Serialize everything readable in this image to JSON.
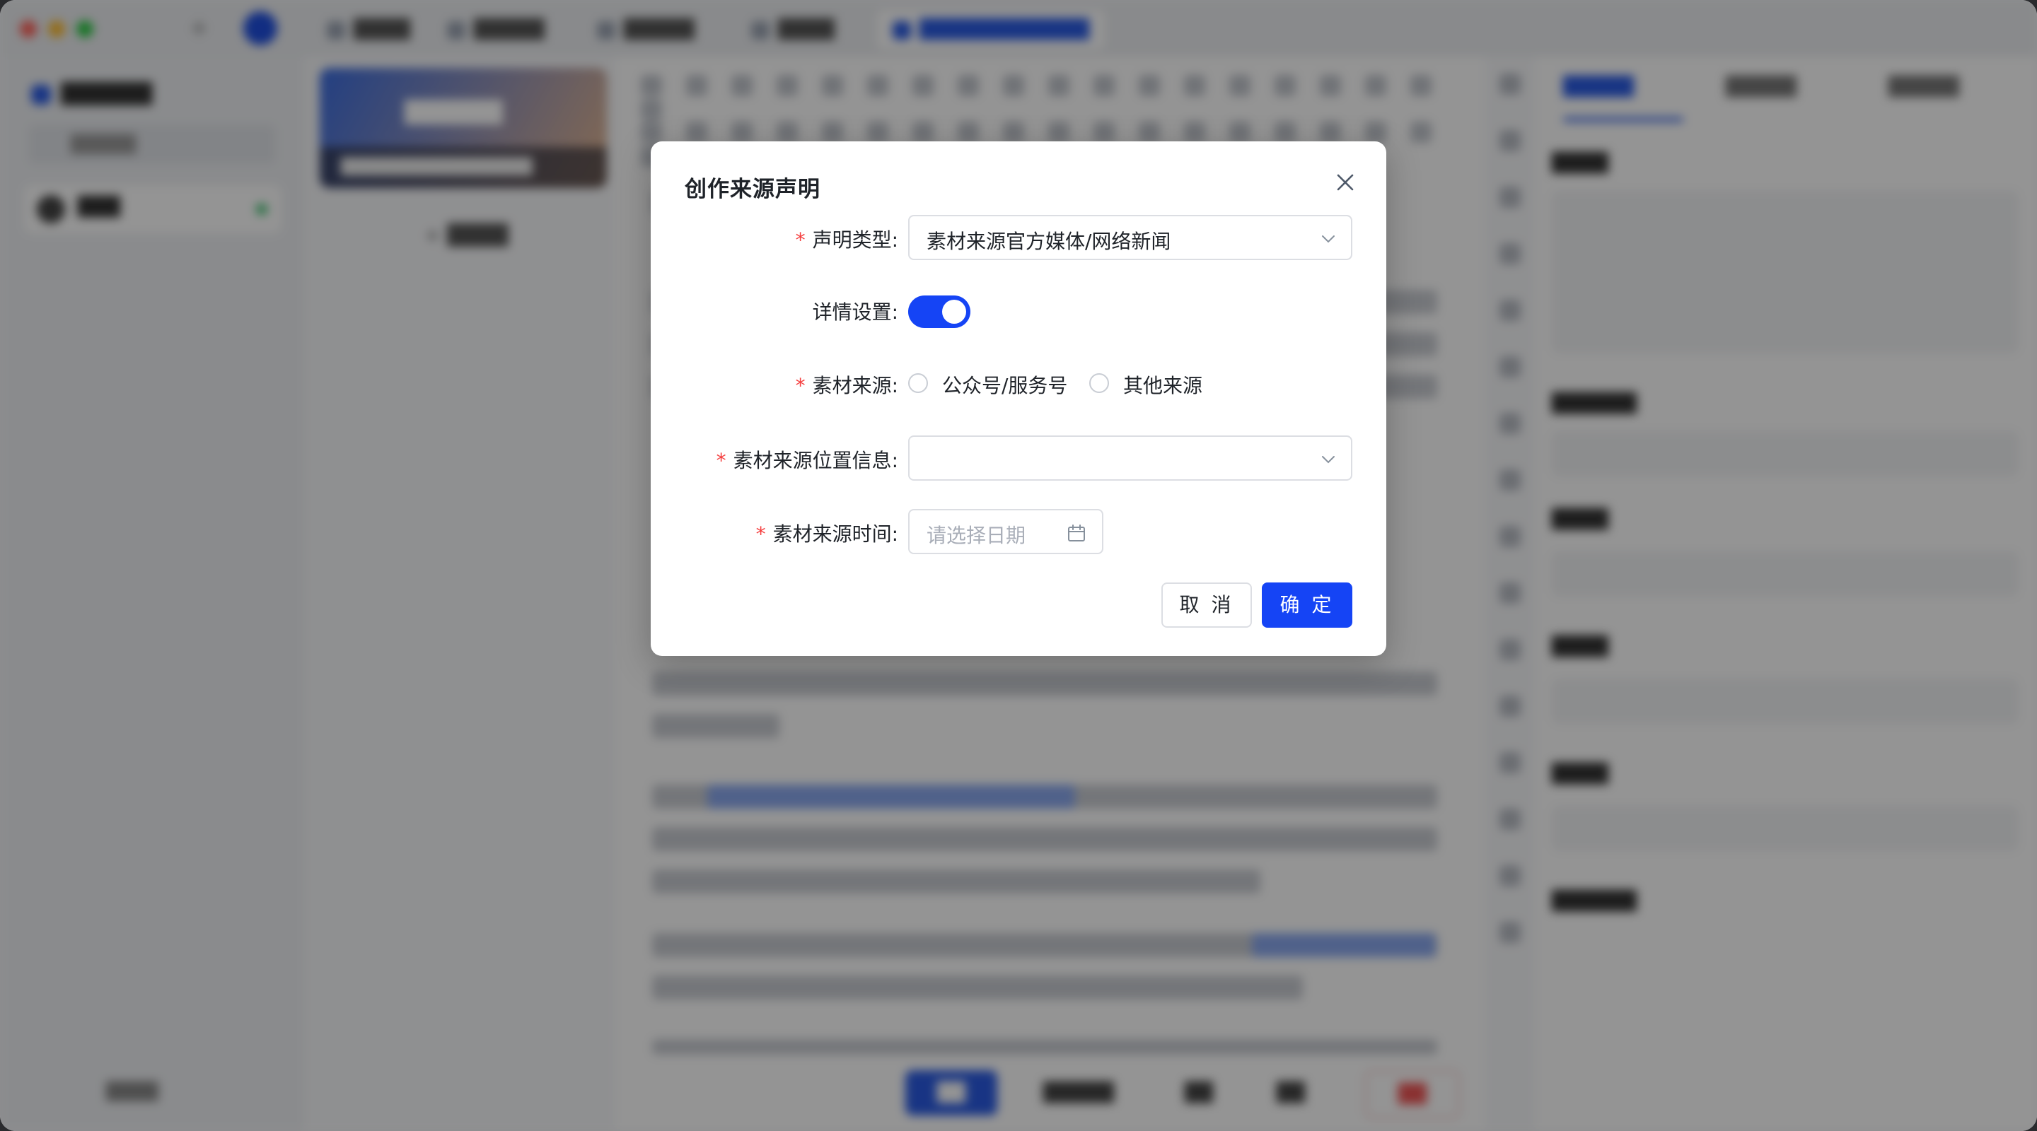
{
  "background_app": {
    "left_sidebar": {
      "brand": "██████",
      "search_placeholder": "█████",
      "user_name": "███",
      "footer": "████"
    },
    "tabs": [
      {
        "label": "████"
      },
      {
        "label": "█████"
      },
      {
        "label": "█████"
      },
      {
        "label": "████"
      },
      {
        "label": "████████████"
      }
    ],
    "doc_card": {
      "title": "██████",
      "subtitle": "████████████████"
    },
    "doc_add": "+ ████",
    "editor_bottom": {
      "primary": "██",
      "b2": "█████",
      "b3": "██",
      "b4": "██",
      "b5": "██"
    },
    "right_panel": {
      "tabs": [
        {
          "label": "█████"
        },
        {
          "label": "█████"
        },
        {
          "label": "█████"
        }
      ],
      "labels": [
        "████",
        "██████",
        "████",
        "████",
        "████",
        "██████"
      ]
    }
  },
  "modal": {
    "title": "创作来源声明",
    "fields": {
      "declaration_type": {
        "label": "声明类型:",
        "value": "素材来源官方媒体/网络新闻"
      },
      "detail_settings": {
        "label": "详情设置:",
        "enabled": true
      },
      "material_source": {
        "label": "素材来源:",
        "options": [
          "公众号/服务号",
          "其他来源"
        ]
      },
      "location_info": {
        "label": "素材来源位置信息:",
        "value": ""
      },
      "source_time": {
        "label": "素材来源时间:",
        "placeholder": "请选择日期"
      }
    },
    "buttons": {
      "cancel": "取 消",
      "confirm": "确 定"
    }
  },
  "colors": {
    "primary": "#1544f5",
    "required": "#f53f3f",
    "border": "#dcdee3"
  }
}
